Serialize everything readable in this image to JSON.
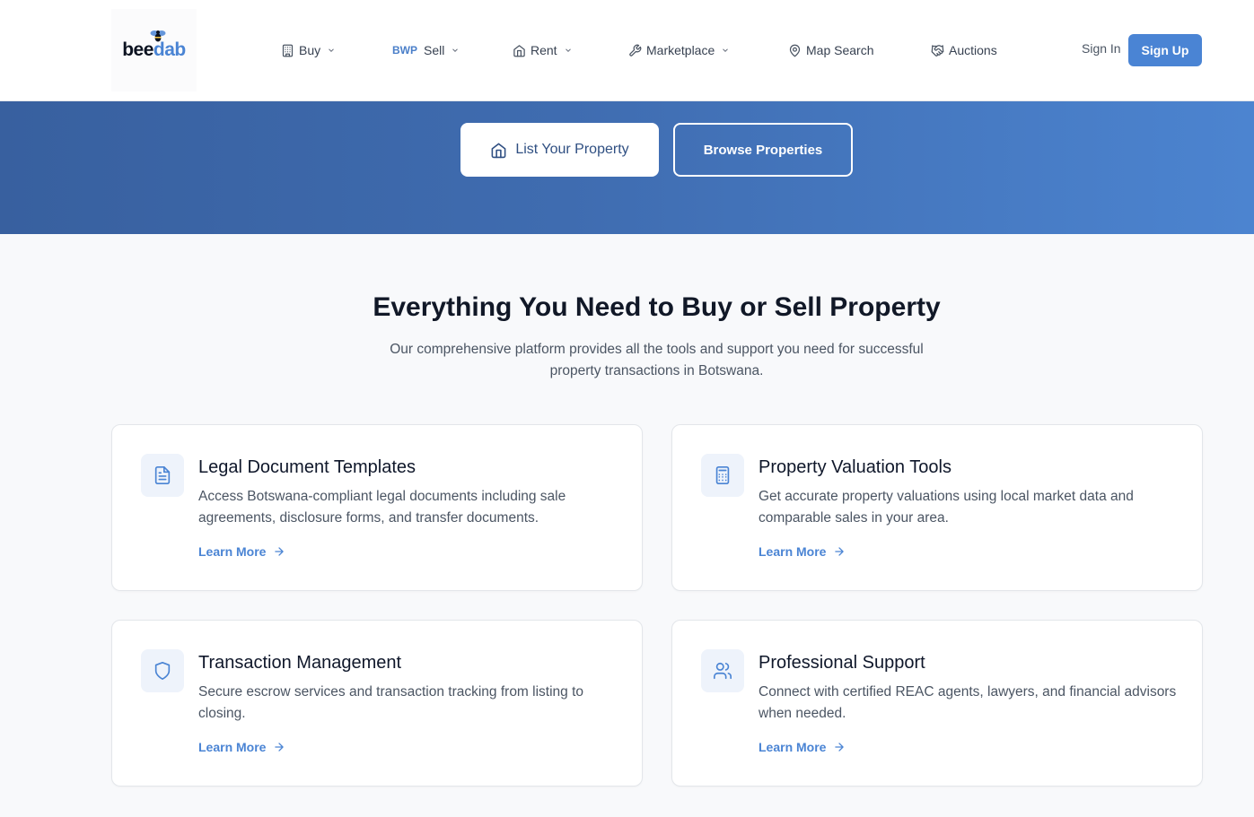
{
  "header": {
    "logo": {
      "part1": "bee",
      "part2": "dab"
    },
    "nav": [
      {
        "label": "Buy",
        "icon": "building-icon",
        "dropdown": true
      },
      {
        "prefix": "BWP",
        "label": "Sell",
        "dropdown": true
      },
      {
        "label": "Rent",
        "icon": "house-icon",
        "dropdown": true
      },
      {
        "label": "Marketplace",
        "icon": "wrench-icon",
        "dropdown": true
      },
      {
        "label": "Map Search",
        "icon": "map-pin-icon",
        "dropdown": false
      },
      {
        "label": "Auctions",
        "icon": "handshake-icon",
        "dropdown": false
      }
    ],
    "sign_in": "Sign In",
    "sign_up": "Sign Up"
  },
  "hero": {
    "list_property": "List Your Property",
    "browse_properties": "Browse Properties"
  },
  "section": {
    "title": "Everything You Need to Buy or Sell Property",
    "subtitle": "Our comprehensive platform provides all the tools and support you need for successful property transactions in Botswana.",
    "cards": [
      {
        "title": "Legal Document Templates",
        "description": "Access Botswana-compliant legal documents including sale agreements, disclosure forms, and transfer documents.",
        "link": "Learn More",
        "icon": "document-icon"
      },
      {
        "title": "Property Valuation Tools",
        "description": "Get accurate property valuations using local market data and comparable sales in your area.",
        "link": "Learn More",
        "icon": "calculator-icon"
      },
      {
        "title": "Transaction Management",
        "description": "Secure escrow services and transaction tracking from listing to closing.",
        "link": "Learn More",
        "icon": "shield-icon"
      },
      {
        "title": "Professional Support",
        "description": "Connect with certified REAC agents, lawyers, and financial advisors when needed.",
        "link": "Learn More",
        "icon": "users-icon"
      }
    ]
  },
  "colors": {
    "accent": "#4a84d4",
    "hero_start": "#38609f",
    "hero_end": "#4c84d0",
    "background": "#f8f9fb"
  }
}
